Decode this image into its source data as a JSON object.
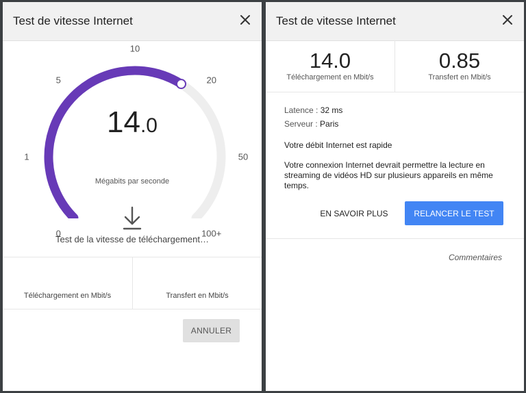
{
  "left_panel": {
    "title": "Test de vitesse Internet",
    "gauge": {
      "ticks": [
        "0",
        "1",
        "5",
        "10",
        "20",
        "50",
        "100+"
      ],
      "value_int": "14",
      "value_dec": ".0",
      "units": "Mégabits par seconde",
      "progress_fraction": 0.62,
      "colors": {
        "accent": "#673ab7",
        "track": "#eeeeee"
      }
    },
    "status": "Test de la vitesse de téléchargement…",
    "stats": {
      "download_label": "Téléchargement en Mbit/s",
      "upload_label": "Transfert en Mbit/s"
    },
    "cancel_label": "ANNULER"
  },
  "right_panel": {
    "title": "Test de vitesse Internet",
    "download": {
      "value": "14.0",
      "label": "Téléchargement en Mbit/s"
    },
    "upload": {
      "value": "0.85",
      "label": "Transfert en Mbit/s"
    },
    "latency": {
      "key": "Latence :",
      "value": "32 ms"
    },
    "server": {
      "key": "Serveur :",
      "value": "Paris"
    },
    "verdict": "Votre débit Internet est rapide",
    "description": "Votre connexion Internet devrait permettre la lecture en streaming de vidéos HD sur plusieurs appareils en même temps.",
    "learn_more_label": "EN SAVOIR PLUS",
    "retry_label": "RELANCER LE TEST",
    "feedback_label": "Commentaires",
    "colors": {
      "button": "#4285f4"
    }
  },
  "icons": [
    "close-icon",
    "download-arrow-icon"
  ]
}
